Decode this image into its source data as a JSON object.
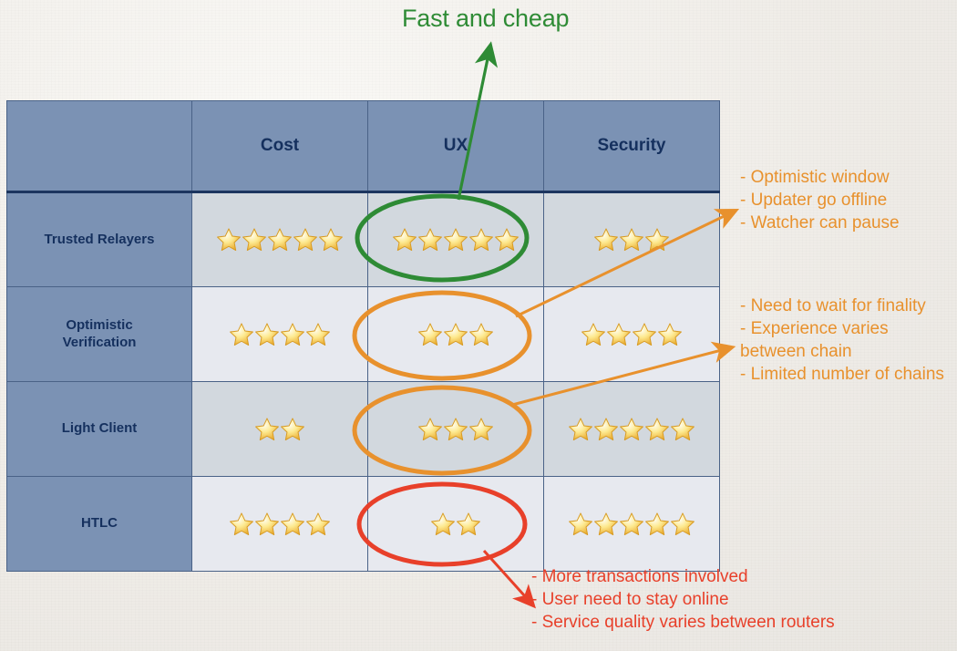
{
  "title": {
    "text": "Fast and cheap",
    "color": "#2e8b35"
  },
  "table": {
    "corner_label": "",
    "columns": [
      "Cost",
      "UX",
      "Security"
    ],
    "rows": [
      {
        "label": "Trusted Relayers",
        "cost": 5,
        "ux": 5,
        "security": 3
      },
      {
        "label": "Optimistic\nVerification",
        "cost": 4,
        "ux": 3,
        "security": 4
      },
      {
        "label": "Light Client",
        "cost": 2,
        "ux": 3,
        "security": 5
      },
      {
        "label": "HTLC",
        "cost": 4,
        "ux": 2,
        "security": 5
      }
    ],
    "header_bg": "#7b92b4",
    "header_text_color": "#15305e",
    "row_bg_dark": "#d2d8de",
    "row_bg_light": "#e7e9ef",
    "border_color": "#4a6287"
  },
  "annotations": {
    "optimistic_window": "- Optimistic window\n-  Updater go offline\n-  Watcher can pause",
    "finality": "- Need to wait for finality\n- Experience varies between chain\n- Limited number of chains",
    "htlc": "- More transactions involved\n- User need to stay online\n- Service quality varies between routers"
  },
  "highlights": {
    "green_ellipse_label": "trusted-relayers-ux",
    "orange_ellipse_1_label": "optimistic-verification-ux",
    "orange_ellipse_2_label": "light-client-ux",
    "red_ellipse_label": "htlc-ux",
    "green": "#2e8b35",
    "orange": "#e8912d",
    "red": "#e8402a"
  },
  "chart_data": {
    "type": "table",
    "title": "Fast and cheap",
    "categories": [
      "Cost",
      "UX",
      "Security"
    ],
    "series": [
      {
        "name": "Trusted Relayers",
        "values": [
          5,
          5,
          3
        ]
      },
      {
        "name": "Optimistic Verification",
        "values": [
          4,
          3,
          4
        ]
      },
      {
        "name": "Light Client",
        "values": [
          2,
          3,
          5
        ]
      },
      {
        "name": "HTLC",
        "values": [
          4,
          2,
          5
        ]
      }
    ],
    "scale_max": 5,
    "unit": "stars",
    "annotations": [
      {
        "target": "Trusted Relayers / UX",
        "color": "#2e8b35",
        "text": "Fast and cheap"
      },
      {
        "target": "Optimistic Verification / UX",
        "color": "#e8912d",
        "text": "- Optimistic window\n-  Updater go offline\n-  Watcher can pause"
      },
      {
        "target": "Light Client / UX",
        "color": "#e8912d",
        "text": "- Need to wait for finality\n- Experience varies between chain\n- Limited number of chains"
      },
      {
        "target": "HTLC / UX",
        "color": "#e8402a",
        "text": "- More transactions involved\n- User need to stay online\n- Service quality varies between routers"
      }
    ]
  }
}
